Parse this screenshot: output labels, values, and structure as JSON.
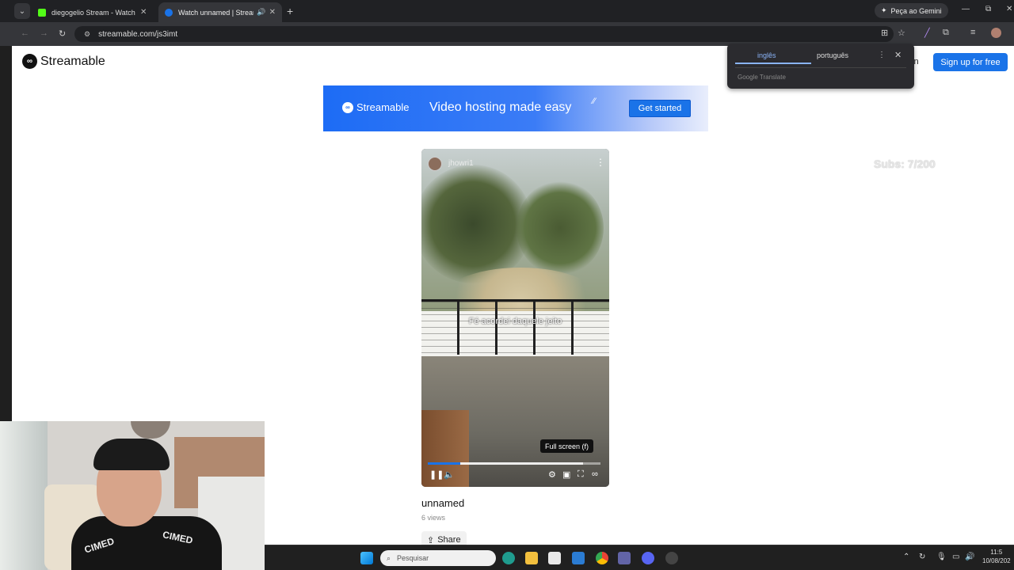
{
  "browser": {
    "tabs": [
      {
        "title": "diegogelio Stream - Watch Live",
        "favicon_color": "#53fc18"
      },
      {
        "title": "Watch unnamed | Streamable",
        "favicon_color": "#1a73e8",
        "active": true
      }
    ],
    "new_tab": "+",
    "gemini_label": "Peça ao Gemini",
    "url": "streamable.com/js3imt",
    "window_controls": {
      "minimize": "—",
      "maximize": "⧉",
      "close": "✕"
    }
  },
  "translate_popup": {
    "source_lang": "inglês",
    "target_lang": "português",
    "brand": "Google Translate"
  },
  "header": {
    "logo_text": "Streamable",
    "login": "in",
    "signup": "Sign up for free"
  },
  "banner": {
    "logo_text": "Streamable",
    "tagline": "Video hosting made easy",
    "cta": "Get started"
  },
  "overlay": {
    "subs": "Subs: 7/200"
  },
  "video": {
    "username": "jhowri1",
    "caption": "Fé acordei daquele jeito",
    "tooltip": "Full screen (f)",
    "progress": 0.19,
    "buffered": 0.9
  },
  "meta": {
    "title": "unnamed",
    "views": "6 views",
    "share": "Share"
  },
  "webcam": {
    "shirt_text_left": "CIMED",
    "shirt_text_right": "CIMED"
  },
  "taskbar": {
    "search_placeholder": "Pesquisar",
    "time": "11:5",
    "date": "10/08/202"
  }
}
